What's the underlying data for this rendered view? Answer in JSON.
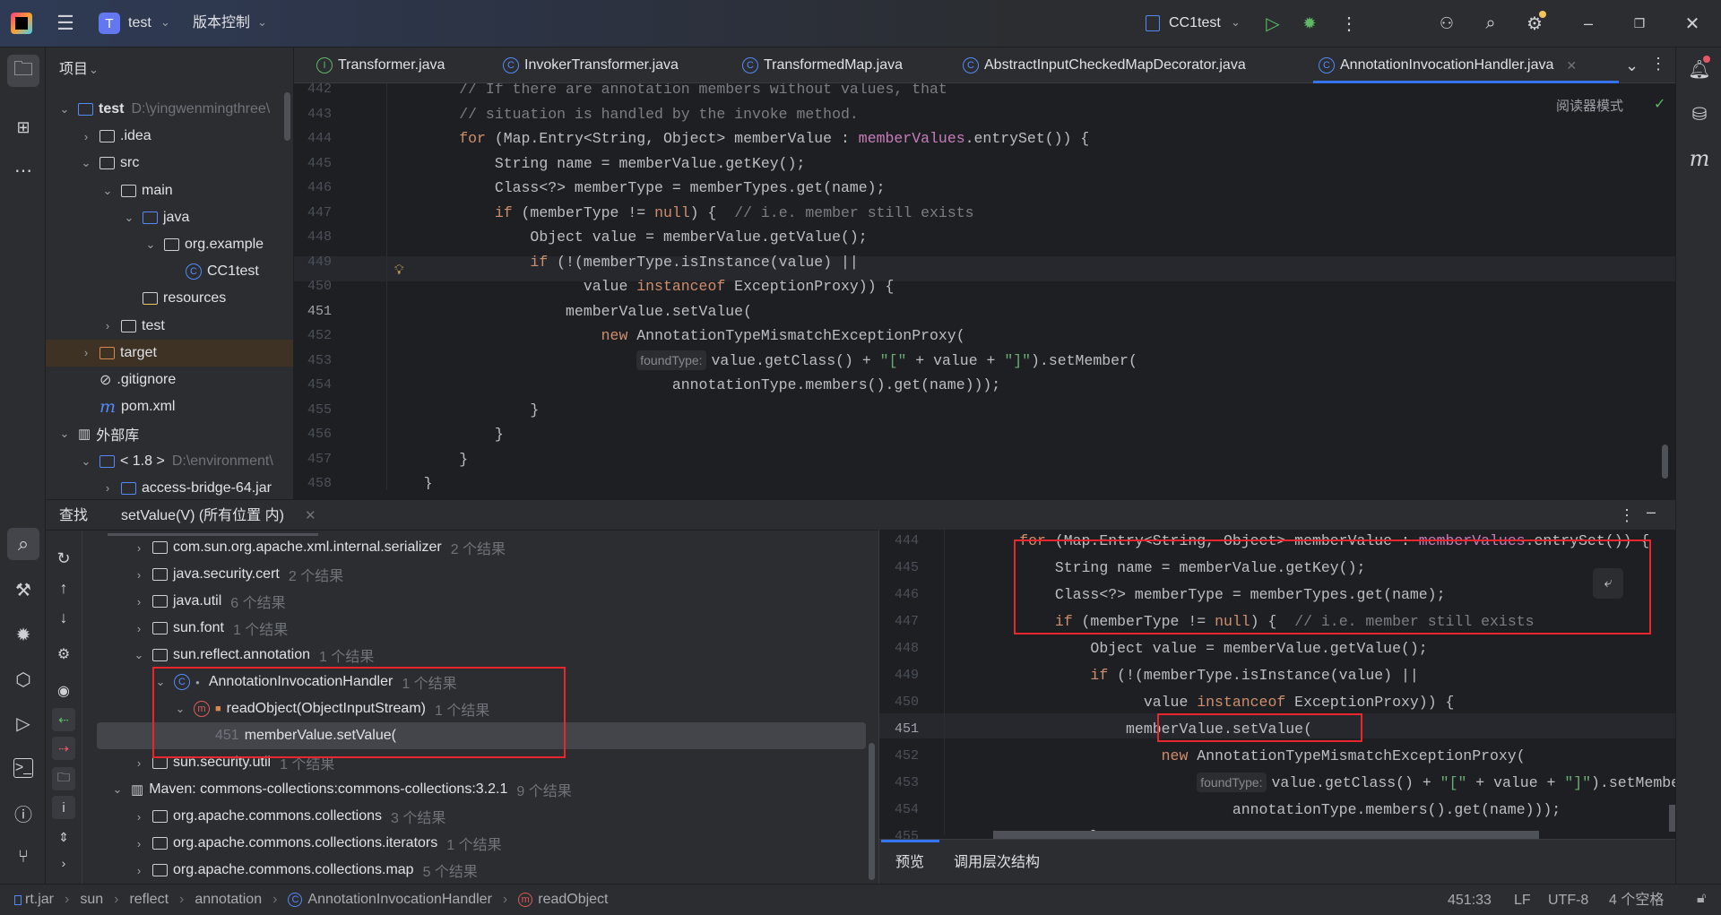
{
  "titlebar": {
    "project_badge": "T",
    "project_name": "test",
    "vcs_menu": "版本控制",
    "run_config": "CC1test",
    "accent": "#3574f0"
  },
  "left_toolbar": {
    "top_icons": [
      "folder-icon",
      "structure-icon",
      "more-icon"
    ],
    "bottom_icons": [
      "search-icon",
      "hammer-icon",
      "bug-icon",
      "services-icon",
      "run-icon",
      "terminal-icon",
      "problems-icon",
      "git-icon"
    ]
  },
  "project_panel": {
    "title": "项目",
    "items": [
      {
        "level": 0,
        "chevron": "down",
        "icon": "module",
        "label": "test",
        "hint": "D:\\yingwenmingthree\\"
      },
      {
        "level": 1,
        "chevron": "right",
        "icon": "folder",
        "label": ".idea"
      },
      {
        "level": 1,
        "chevron": "down",
        "icon": "folder",
        "label": "src"
      },
      {
        "level": 2,
        "chevron": "down",
        "icon": "folder",
        "label": "main"
      },
      {
        "level": 3,
        "chevron": "down",
        "icon": "folder-blue",
        "label": "java"
      },
      {
        "level": 4,
        "chevron": "down",
        "icon": "package",
        "label": "org.example"
      },
      {
        "level": 5,
        "chevron": "",
        "icon": "class",
        "label": "CC1test"
      },
      {
        "level": 3,
        "chevron": "",
        "icon": "folder-res",
        "label": "resources"
      },
      {
        "level": 2,
        "chevron": "right",
        "icon": "folder",
        "label": "test"
      },
      {
        "level": 1,
        "chevron": "right",
        "icon": "folder-orange",
        "label": "target",
        "highlight": true
      },
      {
        "level": 1,
        "chevron": "",
        "icon": "gitignore",
        "label": ".gitignore"
      },
      {
        "level": 1,
        "chevron": "",
        "icon": "maven",
        "label": "pom.xml"
      },
      {
        "level": 0,
        "chevron": "down",
        "icon": "library",
        "label": "外部库"
      },
      {
        "level": 1,
        "chevron": "down",
        "icon": "jdk",
        "label": "< 1.8 >",
        "hint": "D:\\environment\\"
      },
      {
        "level": 2,
        "chevron": "right",
        "icon": "jar",
        "label": "access-bridge-64.jar"
      }
    ]
  },
  "editor": {
    "tabs": [
      {
        "label": "Transformer.java",
        "icon": "interface"
      },
      {
        "label": "InvokerTransformer.java",
        "icon": "class"
      },
      {
        "label": "TransformedMap.java",
        "icon": "class"
      },
      {
        "label": "AbstractInputCheckedMapDecorator.java",
        "icon": "class"
      },
      {
        "label": "AnnotationInvocationHandler.java",
        "icon": "class",
        "active": true
      }
    ],
    "reader_mode": "阅读器模式",
    "current_line": 451,
    "lines": [
      {
        "n": 442,
        "tokens": [
          [
            "cm",
            "        // If there are annotation members without values, that"
          ]
        ]
      },
      {
        "n": 443,
        "tokens": [
          [
            "cm",
            "        // situation is handled by the invoke method."
          ]
        ]
      },
      {
        "n": 444,
        "tokens": [
          [
            "kw",
            "        for"
          ],
          [
            "df",
            " (Map.Entry<String, Object> memberValue : "
          ],
          [
            "fd",
            "memberValues"
          ],
          [
            "df",
            ".entrySet()) {"
          ]
        ]
      },
      {
        "n": 445,
        "tokens": [
          [
            "df",
            "            String name = memberValue.getKey();"
          ]
        ]
      },
      {
        "n": 446,
        "tokens": [
          [
            "df",
            "            Class<?> memberType = memberTypes.get(name);"
          ]
        ]
      },
      {
        "n": 447,
        "tokens": [
          [
            "kw",
            "            if"
          ],
          [
            "df",
            " (memberType != "
          ],
          [
            "kw",
            "null"
          ],
          [
            "df",
            ") {  "
          ],
          [
            "cm",
            "// i.e. member still exists"
          ]
        ]
      },
      {
        "n": 448,
        "tokens": [
          [
            "df",
            "                Object value = memberValue.getValue();"
          ]
        ]
      },
      {
        "n": 449,
        "tokens": [
          [
            "kw",
            "                if"
          ],
          [
            "df",
            " (!(memberType.isInstance(value) ||"
          ]
        ]
      },
      {
        "n": 450,
        "tokens": [
          [
            "df",
            "                      value "
          ],
          [
            "kw",
            "instanceof"
          ],
          [
            "df",
            " ExceptionProxy)) {"
          ]
        ]
      },
      {
        "n": 451,
        "tokens": [
          [
            "df",
            "                    memberValue.setValue("
          ]
        ]
      },
      {
        "n": 452,
        "tokens": [
          [
            "kw",
            "                        new"
          ],
          [
            "df",
            " AnnotationTypeMismatchExceptionProxy("
          ]
        ]
      },
      {
        "n": 453,
        "inlay": "foundType:",
        "tokens": [
          [
            "df",
            "value.getClass() + "
          ],
          [
            "st",
            "\"[\""
          ],
          [
            "df",
            " + value + "
          ],
          [
            "st",
            "\"]\""
          ],
          [
            "df",
            ").setMember("
          ]
        ]
      },
      {
        "n": 454,
        "tokens": [
          [
            "df",
            "                                annotationType.members().get(name)));"
          ]
        ]
      },
      {
        "n": 455,
        "tokens": [
          [
            "df",
            "                }"
          ]
        ]
      },
      {
        "n": 456,
        "tokens": [
          [
            "df",
            "            }"
          ]
        ]
      },
      {
        "n": 457,
        "tokens": [
          [
            "df",
            "        }"
          ]
        ]
      },
      {
        "n": 458,
        "tokens": [
          [
            "df",
            "    }"
          ]
        ]
      }
    ]
  },
  "find_panel": {
    "title": "查找",
    "tab_label": "setValue(V) (所有位置 内)",
    "tree": [
      {
        "level": 2,
        "chevron": "right",
        "icon": "package",
        "label": "com.sun.org.apache.xml.internal.serializer",
        "count": "2 个结果"
      },
      {
        "level": 2,
        "chevron": "right",
        "icon": "package",
        "label": "java.security.cert",
        "count": "2 个结果"
      },
      {
        "level": 2,
        "chevron": "right",
        "icon": "package",
        "label": "java.util",
        "count": "6 个结果"
      },
      {
        "level": 2,
        "chevron": "right",
        "icon": "package",
        "label": "sun.font",
        "count": "1 个结果"
      },
      {
        "level": 2,
        "chevron": "down",
        "icon": "package",
        "label": "sun.reflect.annotation",
        "count": "1 个结果"
      },
      {
        "level": 3,
        "chevron": "down",
        "icon": "class",
        "label": "AnnotationInvocationHandler",
        "count": "1 个结果"
      },
      {
        "level": 4,
        "chevron": "down",
        "icon": "method",
        "label": "readObject(ObjectInputStream)",
        "count": "1 个结果"
      },
      {
        "level": 5,
        "chevron": "",
        "icon": "",
        "line": "451",
        "label": "memberValue.setValue(",
        "selected": true
      },
      {
        "level": 2,
        "chevron": "right",
        "icon": "package",
        "label": "sun.security.util",
        "count": "1 个结果"
      },
      {
        "level": 1,
        "chevron": "down",
        "icon": "library",
        "label": "Maven: commons-collections:commons-collections:3.2.1",
        "count": "9 个结果"
      },
      {
        "level": 2,
        "chevron": "right",
        "icon": "package",
        "label": "org.apache.commons.collections",
        "count": "3 个结果"
      },
      {
        "level": 2,
        "chevron": "right",
        "icon": "package",
        "label": "org.apache.commons.collections.iterators",
        "count": "1 个结果"
      },
      {
        "level": 2,
        "chevron": "right",
        "icon": "package",
        "label": "org.apache.commons.collections.map",
        "count": "5 个结果"
      }
    ],
    "preview_range": [
      444,
      455
    ],
    "bottom_tabs": [
      "预览",
      "调用层次结构"
    ]
  },
  "status_bar": {
    "breadcrumbs": [
      "rt.jar",
      "sun",
      "reflect",
      "annotation",
      "AnnotationInvocationHandler",
      "readObject"
    ],
    "position": "451:33",
    "line_sep": "LF",
    "encoding": "UTF-8",
    "indent": "4 个空格"
  },
  "colors": {
    "keyword": "#cf8e6d",
    "comment": "#7a7e85",
    "field": "#c77dbb",
    "string": "#6aab73",
    "highlight_box": "#e8262b"
  }
}
